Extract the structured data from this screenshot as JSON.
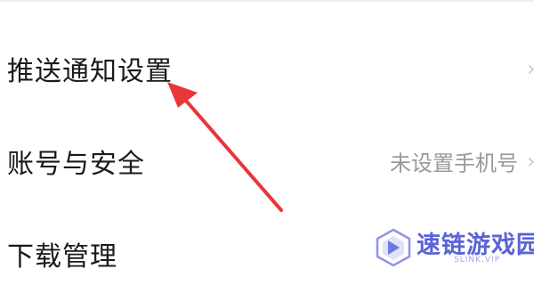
{
  "settings": {
    "items": [
      {
        "label": "推送通知设置",
        "value": ""
      },
      {
        "label": "账号与安全",
        "value": "未设置手机号"
      },
      {
        "label": "下载管理",
        "value": ""
      }
    ]
  },
  "annotation": {
    "arrow_color": "#e8363a",
    "icon": "red-arrow-icon"
  },
  "watermark": {
    "title": "速链游戏园",
    "subtitle": "SLINK.VIP",
    "accent_color": "#5a63d6"
  }
}
